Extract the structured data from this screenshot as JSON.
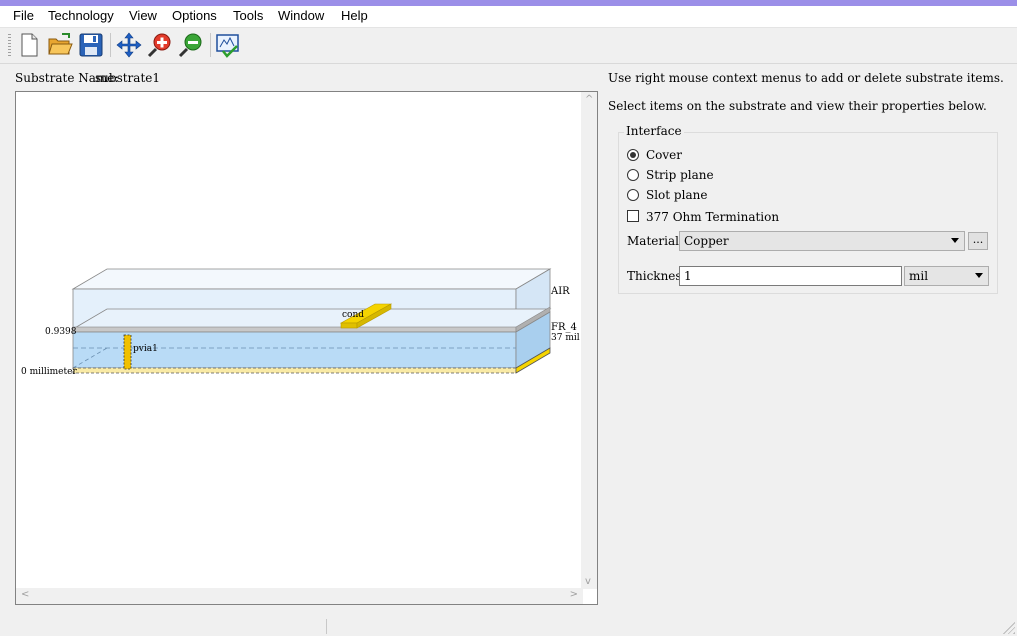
{
  "menu": [
    "File",
    "Technology",
    "View",
    "Options",
    "Tools",
    "Window",
    "Help"
  ],
  "toolbar_icons": [
    "new-file-icon",
    "open-folder-icon",
    "save-disk-icon",
    "pan-arrows-icon",
    "zoom-in-icon",
    "zoom-out-icon",
    "check-layout-icon"
  ],
  "substrate": {
    "name_label": "Substrate Name:",
    "name_value": "substrate1"
  },
  "diagram": {
    "layer_air": "AIR",
    "layer_fr4": "FR_4",
    "layer_fr4_thickness": "37 mil",
    "height_top": "0.9398",
    "height_bottom": "0 millimeter",
    "conductor_label": "cond",
    "via_label": "pvia1",
    "colors": {
      "air": "#e4f0fb",
      "dielectric": "#b9dbf6",
      "metal": "#f5d400",
      "ground": "#f9eaa6"
    }
  },
  "info": {
    "line1": "Use right mouse context menus to add or delete substrate items.",
    "line2": "Select items on the substrate and view their properties below."
  },
  "interface": {
    "title": "Interface",
    "options": [
      "Cover",
      "Strip plane",
      "Slot plane"
    ],
    "selected": "Cover",
    "termination_label": "377 Ohm Termination",
    "termination_checked": false,
    "material_label": "Material",
    "material_value": "Copper",
    "browse_label": "...",
    "thickness_label": "Thickness",
    "thickness_value": "1",
    "thickness_unit": "mil"
  },
  "scroll_arrows": {
    "up": "^",
    "down": "v",
    "left": "<",
    "right": ">"
  }
}
